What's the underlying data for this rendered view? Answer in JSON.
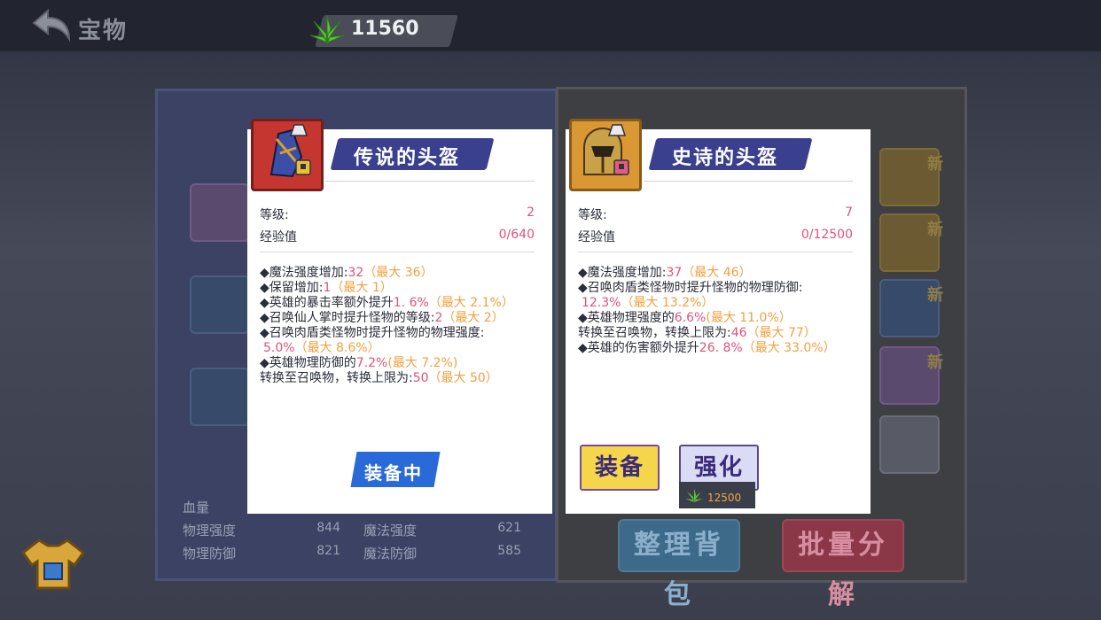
{
  "header": {
    "title": "宝物",
    "currency_amount": "11560"
  },
  "background": {
    "stats": [
      {
        "label": "血量",
        "value": ""
      },
      {
        "label": "物理强度",
        "value": "844"
      },
      {
        "label": "物理防御",
        "value": "821"
      },
      {
        "label": "魔法强度",
        "value": "621"
      },
      {
        "label": "魔法防御",
        "value": "585"
      }
    ],
    "new_badge": "新",
    "sort_button": "整理背包",
    "decompose_button": "批量分解"
  },
  "left_card": {
    "name": "传说的头盔",
    "level_label": "等级:",
    "level_value": "2",
    "exp_label": "经验值",
    "exp_value": "0/640",
    "attributes": [
      {
        "text": "◆魔法强度增加:",
        "val": "32",
        "max": "（最大 36）"
      },
      {
        "text": "◆保留增加:",
        "val": "1",
        "max": "（最大 1）"
      },
      {
        "text": "◆英雄的暴击率额外提升",
        "val": "1. 6%",
        "max": "（最大 2.1%）"
      },
      {
        "text": "◆召唤仙人掌时提升怪物的等级:",
        "val": "2",
        "max": "（最大 2）"
      },
      {
        "text": "◆召唤肉盾类怪物时提升怪物的物理强度:",
        "val": "",
        "max": ""
      },
      {
        "text": "",
        "val": "5.0%",
        "max": "（最大 8.6%）"
      },
      {
        "text": "◆英雄物理防御的",
        "val": "7.2%",
        "max": "(最大 7.2%)"
      },
      {
        "text": "转换至召唤物，转换上限为:",
        "val": "50",
        "max": "（最大 50）"
      }
    ],
    "equipped_label": "装备中"
  },
  "right_card": {
    "name": "史诗的头盔",
    "level_label": "等级:",
    "level_value": "7",
    "exp_label": "经验值",
    "exp_value": "0/12500",
    "attributes": [
      {
        "text": "◆魔法强度增加:",
        "val": "37",
        "max": "（最大 46）"
      },
      {
        "text": "◆召唤肉盾类怪物时提升怪物的物理防御:",
        "val": "",
        "max": ""
      },
      {
        "text": "",
        "val": "12.3%",
        "max": "（最大 13.2%）"
      },
      {
        "text": "◆英雄物理强度的",
        "val": "6.6%",
        "max": "(最大 11.0%）"
      },
      {
        "text": "转换至召唤物，转换上限为:",
        "val": "46",
        "max": "（最大 77）"
      },
      {
        "text": "◆英雄的伤害额外提升",
        "val": "26. 8%",
        "max": "（最大 33.0%）"
      }
    ],
    "equip_button": "装备",
    "upgrade_button": "强化",
    "upgrade_cost": "12500"
  }
}
